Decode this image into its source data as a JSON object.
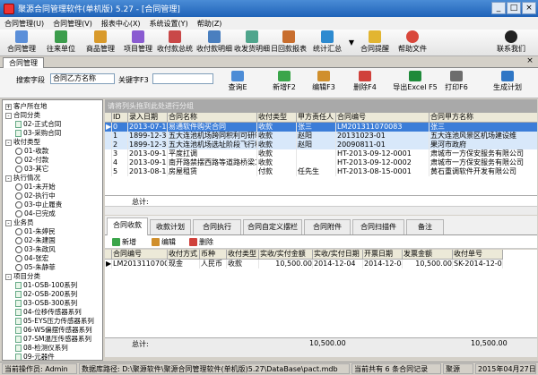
{
  "window": {
    "title": "聚源合同管理软件(单机版) 5.27 - [合同管理]"
  },
  "menu": [
    "合同管理(U)",
    "合同管理(V)",
    "报表中心(X)",
    "系统设置(Y)",
    "帮助(Z)"
  ],
  "toolbar": [
    "合同管理",
    "往来单位",
    "商品管理",
    "项目管理",
    "收付款总统",
    "收付款明细",
    "收发货明细",
    "日回款报表",
    "统计汇总",
    "合同提醒",
    "帮助文件",
    "联系我们"
  ],
  "module_tab": "合同管理",
  "search": {
    "field_label": "搜索字段",
    "field_value": "合同乙方名称",
    "keyword_label": "关键字F3",
    "keyword_value": ""
  },
  "actions": [
    "查询E",
    "新增F2",
    "编辑F3",
    "删除F4",
    "导出Excel F5",
    "打印F6",
    "生成计划"
  ],
  "tree": [
    {
      "label": "客户所在地",
      "level": 0,
      "type": "box",
      "sign": "+"
    },
    {
      "label": "合同分类",
      "level": 0,
      "type": "box",
      "sign": "-"
    },
    {
      "label": "02-正式合同",
      "level": 1,
      "type": "sq"
    },
    {
      "label": "03-采购合同",
      "level": 1,
      "type": "sq"
    },
    {
      "label": "收付类型",
      "level": 0,
      "type": "box",
      "sign": "-"
    },
    {
      "label": "01-收款",
      "level": 1,
      "type": "ci"
    },
    {
      "label": "02-付款",
      "level": 1,
      "type": "ci"
    },
    {
      "label": "03-其它",
      "level": 1,
      "type": "ci"
    },
    {
      "label": "执行情况",
      "level": 0,
      "type": "box",
      "sign": "-"
    },
    {
      "label": "01-未开始",
      "level": 1,
      "type": "ci"
    },
    {
      "label": "02-执行中",
      "level": 1,
      "type": "ci"
    },
    {
      "label": "03-中止履责",
      "level": 1,
      "type": "ci"
    },
    {
      "label": "04-已完成",
      "level": 1,
      "type": "ci"
    },
    {
      "label": "业务员",
      "level": 0,
      "type": "box",
      "sign": "-"
    },
    {
      "label": "01-朱婷民",
      "level": 1,
      "type": "ci"
    },
    {
      "label": "02-朱建国",
      "level": 1,
      "type": "ci"
    },
    {
      "label": "03-朱政风",
      "level": 1,
      "type": "ci"
    },
    {
      "label": "04-张宏",
      "level": 1,
      "type": "ci"
    },
    {
      "label": "05-朱静菲",
      "level": 1,
      "type": "ci"
    },
    {
      "label": "项目分类",
      "level": 0,
      "type": "box",
      "sign": "-"
    },
    {
      "label": "01-OSB-100系列",
      "level": 1,
      "type": "sq"
    },
    {
      "label": "02-OSB-200系列",
      "level": 1,
      "type": "sq"
    },
    {
      "label": "03-OSB-300系列",
      "level": 1,
      "type": "sq"
    },
    {
      "label": "04-位移传感器系列",
      "level": 1,
      "type": "sq"
    },
    {
      "label": "05-EYS压力传感器系列",
      "level": 1,
      "type": "sq"
    },
    {
      "label": "06-WS偏摆传感器系列",
      "level": 1,
      "type": "sq"
    },
    {
      "label": "07-SM温压传感器系列",
      "level": 1,
      "type": "sq"
    },
    {
      "label": "08-检测仪系列",
      "level": 1,
      "type": "sq"
    },
    {
      "label": "09-元器件",
      "level": 1,
      "type": "sq"
    }
  ],
  "group_hint": "请将列头拖到此处进行分组",
  "grid": {
    "columns": [
      "ID",
      "录入日期",
      "合同名称",
      "收付类型",
      "甲方责任人",
      "合同编号",
      "合同甲方名称"
    ],
    "rows": [
      [
        "0",
        "2013-07-19",
        "易通软件购买合同",
        "收款",
        "张三",
        "LM201311070083",
        "张三"
      ],
      [
        "1",
        "1899-12-30",
        "五大连池机场跨同积利可研制作飞行程序设计",
        "收款",
        "赵阳",
        "20131023-01",
        "五大连池风景区机场建设维"
      ],
      [
        "2",
        "1899-12-30",
        "五大连池机场选址阶段飞行程序设计",
        "收款",
        "赵阳",
        "20090811-01",
        "果河市政府"
      ],
      [
        "3",
        "2013-09-12",
        "平度扛调",
        "收款",
        "",
        "HT-2013-09-12-0001",
        "肃城市一方保安服务有限公司"
      ],
      [
        "4",
        "2013-09-12",
        "南开路禁摆西路等道路桥梁工程",
        "收款",
        "",
        "HT-2013-09-12-0002",
        "肃城市一方保安服务有限公司"
      ],
      [
        "5",
        "2013-08-15",
        "房屋租赁",
        "付款",
        "任先生",
        "HT-2013-08-15-0001",
        "黄石重调软件开发有限公司"
      ]
    ]
  },
  "grid_footer": "总计:",
  "detail_tabs": [
    "合同收款",
    "收款计划",
    "合同执行",
    "合同自定义摆栏",
    "合同附件",
    "合同扫描件",
    "备注"
  ],
  "detail_actions": [
    "新增",
    "编辑",
    "删除"
  ],
  "detail_grid": {
    "columns": [
      "合同编号",
      "收付方式",
      "币种",
      "收付类型",
      "实收/实付金额",
      "实收/实付日期",
      "开票日期",
      "发票金额",
      "收付单号"
    ],
    "rows": [
      [
        "LM201311070083",
        "现金",
        "人民币",
        "收款",
        "10,500.00",
        "2014-12-04",
        "2014-12-04",
        "10,500.00",
        "SK-2014-12-04-"
      ]
    ]
  },
  "detail_footer": {
    "label": "总计:",
    "value1": "10,500.00",
    "value2": "10,500.00"
  },
  "statusbar": {
    "operator": "当前操作员: Admin",
    "db_path": "数据库路径: D:\\聚源软件\\聚源合同管理软件(单机版)5.27\\DataBase\\pact.mdb",
    "records": "当前共有 6 条合同记录",
    "company": "聚源",
    "date": "2015年04月27日"
  }
}
